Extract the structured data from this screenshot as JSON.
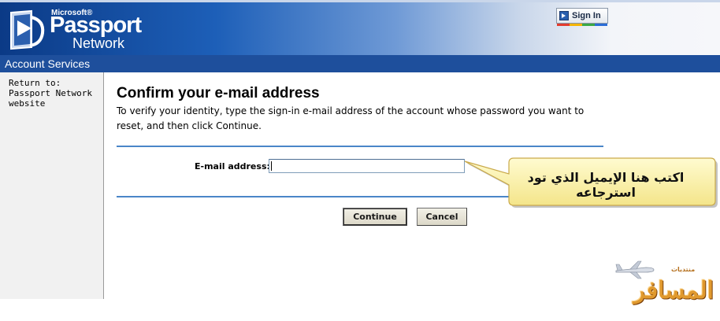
{
  "header": {
    "brand_microsoft": "Microsoft®",
    "brand_passport": "Passport",
    "brand_network": "Network",
    "signin_label": "Sign In"
  },
  "services_bar": {
    "title": "Account Services"
  },
  "sidebar": {
    "return_link": "Return to: Passport Network website"
  },
  "main": {
    "title": "Confirm your e-mail address",
    "instructions": "To verify your identity, type the sign-in e-mail address of the account whose password you want to reset, and then click Continue.",
    "email_label": "E-mail address:",
    "email_value": "",
    "continue_label": "Continue",
    "cancel_label": "Cancel"
  },
  "callout": {
    "text": "اكتب هنا الإيميل الذي تود استرجاعه"
  },
  "watermark": {
    "small": "منتديات",
    "big": "المسافر"
  },
  "colors": {
    "banner_dark": "#0b3a86",
    "services_bar": "#1e4f9c",
    "rule": "#4a86c8",
    "callout_fill": "#fbf4a8",
    "watermark": "#e0992e"
  },
  "icons": {
    "logo": "passport-logo-icon",
    "signin": "passport-signin-icon",
    "watermark_plane": "airplane-icon"
  }
}
